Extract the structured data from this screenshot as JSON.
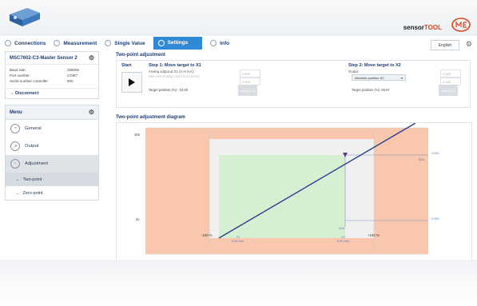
{
  "brand": {
    "sensor": "sensor",
    "tool": "TOOL"
  },
  "language": "English",
  "tabs": [
    {
      "label": "Connections"
    },
    {
      "label": "Measurement"
    },
    {
      "label": "Single Value"
    },
    {
      "label": "Settings",
      "active": true
    },
    {
      "label": "Info"
    }
  ],
  "device": {
    "title": "MSC7602-C3-Master Sensor 2",
    "info": [
      {
        "label": "Baud rate:",
        "value": "256000"
      },
      {
        "label": "Port number:",
        "value": "COM7"
      },
      {
        "label": "Serial number controller:",
        "value": "900"
      }
    ],
    "disconnect": "Disconnect"
  },
  "menu": {
    "title": "Menu",
    "items": [
      {
        "label": "General"
      },
      {
        "label": "Output"
      },
      {
        "label": "Adjustment"
      }
    ],
    "subitems": [
      {
        "label": "Two-point"
      },
      {
        "label": "Zero-point"
      }
    ]
  },
  "adjust": {
    "title": "Two-point adjustment",
    "start": "Start",
    "step1": {
      "title": "Step 1: Move target to X1",
      "line1": "Analog output at X1 (V or mA):",
      "line2": "Use new scaling: Set X1 to (Xmin)",
      "input1": "0.000",
      "input2": "0.000",
      "target_label": "Target position (%):",
      "target_value": "-10.00",
      "button": "Accept X1"
    },
    "step2": {
      "title": "Step 2: Move target to X2",
      "output_label": "Output",
      "select": "Absolute position X2",
      "input1": "0.000",
      "input2": "0.000",
      "target_label": "Target position (%):",
      "target_value": "93.97",
      "button": "Accept X2"
    }
  },
  "diagram": {
    "title": "Two-point adjustment diagram",
    "y_top": "10v",
    "y_bottom": "2v",
    "x_left": "-100 %",
    "x_right": "+100 %",
    "x1_label": "X1",
    "x1_value": "0.00 mm",
    "x2_label": "X2",
    "x2_value": "0.00 mm",
    "point_value": "4.00",
    "right_top": "0.000",
    "right_top2": "8.00",
    "right_bottom": "2.000"
  },
  "colors": {
    "accent": "#2f89d6",
    "range_outer": "#f8c7ad",
    "range_inner": "#f0f0f0",
    "range_green": "#d6efd2",
    "line": "#2a3f8f"
  }
}
